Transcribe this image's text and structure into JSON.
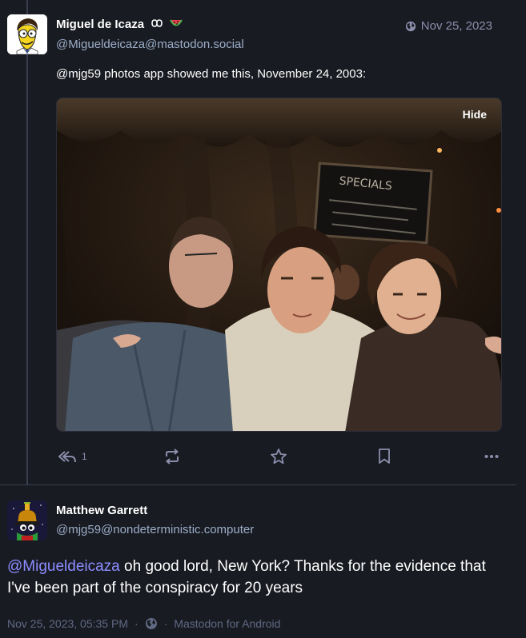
{
  "post": {
    "author": {
      "display_name": "Miguel de Icaza",
      "emojis": [
        "infinity-emoji",
        "watermelon-emoji"
      ],
      "handle": "@Migueldeicaza@mastodon.social"
    },
    "date": "Nov 25, 2023",
    "visibility_icon": "globe-icon",
    "content": {
      "mention": "@mjg59",
      "text": " photos app showed me this, November 24, 2003:"
    },
    "media": {
      "hide_label": "Hide",
      "description": "photo"
    },
    "actions": {
      "reply_count": "1",
      "icons": [
        "reply-all-icon",
        "boost-icon",
        "favourite-icon",
        "bookmark-icon",
        "more-icon"
      ]
    }
  },
  "reply": {
    "author": {
      "display_name": "Matthew Garrett",
      "handle": "@mjg59@nondeterministic.computer"
    },
    "content": {
      "mention": "@Migueldeicaza",
      "text": " oh good lord, New York? Thanks for the evidence that I've been part of the conspiracy for 20 years"
    },
    "meta": {
      "timestamp": "Nov 25, 2023, 05:35 PM",
      "separator": "·",
      "visibility_icon": "globe-icon",
      "application": "Mastodon for Android"
    }
  },
  "colors": {
    "background": "#191b22",
    "handle": "#9baec8",
    "mention": "#8c8dff",
    "icon": "#8c8dab",
    "meta": "#606984"
  }
}
